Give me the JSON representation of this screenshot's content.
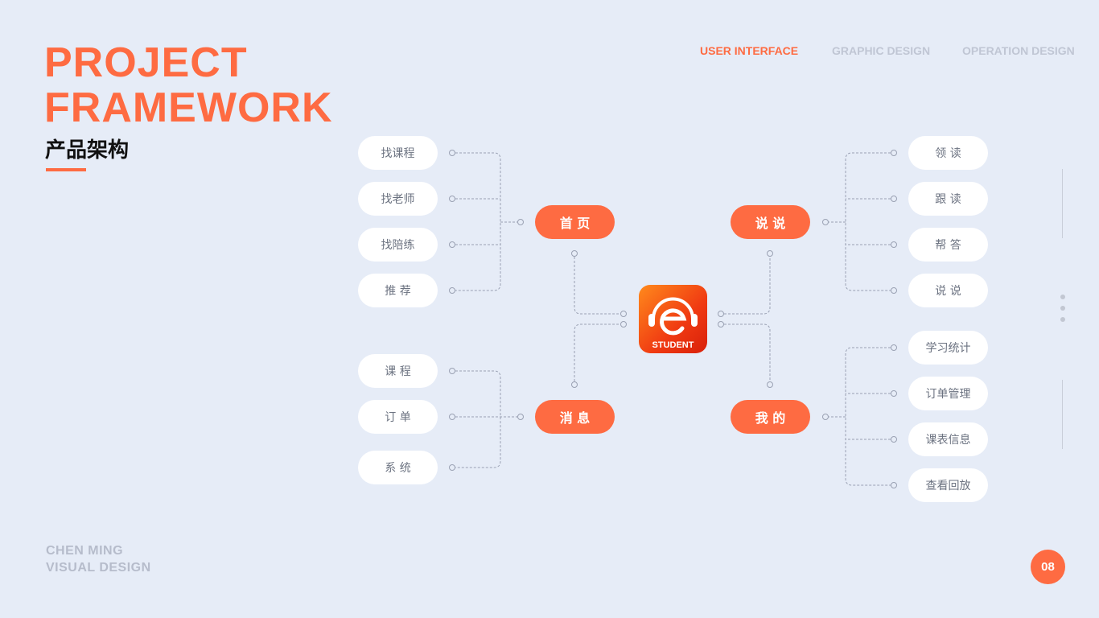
{
  "header": {
    "title_line1": "PROJECT",
    "title_line2": "FRAMEWORK",
    "subtitle": "产品架构"
  },
  "nav": [
    {
      "label": "USER INTERFACE",
      "active": true
    },
    {
      "label": "GRAPHIC DESIGN",
      "active": false
    },
    {
      "label": "OPERATION DESIGN",
      "active": false
    }
  ],
  "footer": {
    "line1": "CHEN MING",
    "line2": "VISUAL DESIGN"
  },
  "page_number": "08",
  "accent_color": "#fe6b42",
  "hub": {
    "label": "STUDENT",
    "icon": "e-headphones-logo"
  },
  "diagram": {
    "home": {
      "label": "首 页",
      "children": [
        "找课程",
        "找老师",
        "找陪练",
        "推 荐"
      ]
    },
    "messages": {
      "label": "消 息",
      "children": [
        "课 程",
        "订 单",
        "系 统"
      ]
    },
    "talk": {
      "label": "说 说",
      "children": [
        "领 读",
        "跟 读",
        "帮 答",
        "说 说"
      ]
    },
    "mine": {
      "label": "我 的",
      "children": [
        "学习统计",
        "订单管理",
        "课表信息",
        "查看回放"
      ]
    }
  }
}
